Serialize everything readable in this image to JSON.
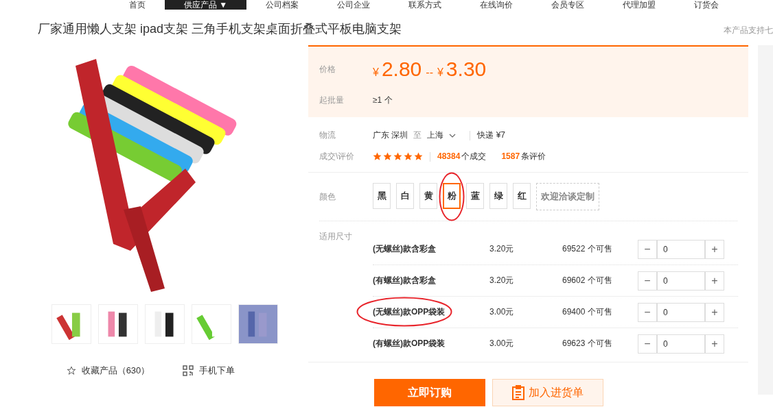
{
  "nav": [
    {
      "label": "首页",
      "selected": false
    },
    {
      "label": "供应产品 ▼",
      "selected": true
    },
    {
      "label": "公司档案",
      "selected": false
    },
    {
      "label": "公司企业",
      "selected": false
    },
    {
      "label": "联系方式",
      "selected": false
    },
    {
      "label": "在线询价",
      "selected": false
    },
    {
      "label": "会员专区",
      "selected": false
    },
    {
      "label": "代理加盟",
      "selected": false
    },
    {
      "label": "订货会",
      "selected": false
    }
  ],
  "title": "厂家通用懒人支架 ipad支架 三角手机支架桌面折叠式平板电脑支架",
  "side_note": "本产品支持七",
  "gallery": {
    "thumbnails": [
      {
        "selected": false
      },
      {
        "selected": false
      },
      {
        "selected": false
      },
      {
        "selected": false
      },
      {
        "selected": false
      }
    ],
    "favorite": "收藏产品（630）",
    "mobile_order": "手机下单"
  },
  "price": {
    "label": "价格",
    "currency_1": "¥",
    "low": "2.80",
    "separator": "--",
    "currency_2": "¥",
    "high": "3.30",
    "moq_label": "起批量",
    "moq": "≥1 个"
  },
  "logistics": {
    "label": "物流",
    "from": "广东 深圳",
    "to_word": "至",
    "to": "上海",
    "method": "快递 ¥7"
  },
  "deals": {
    "label": "成交\\评价",
    "stars": 5,
    "deal_count": "48384",
    "deal_suffix": "个成交",
    "review_count": "1587",
    "review_suffix": "条评价"
  },
  "colors": {
    "label": "颜色",
    "options": [
      {
        "label": "黑",
        "selected": false,
        "circled": false
      },
      {
        "label": "白",
        "selected": false,
        "circled": false
      },
      {
        "label": "黄",
        "selected": false,
        "circled": false
      },
      {
        "label": "粉",
        "selected": true,
        "circled": true
      },
      {
        "label": "蓝",
        "selected": false,
        "circled": false
      },
      {
        "label": "绿",
        "selected": false,
        "circled": false
      },
      {
        "label": "红",
        "selected": false,
        "circled": false
      }
    ],
    "custom": "欢迎洽谈定制"
  },
  "sizes": {
    "label": "适用尺寸",
    "rows": [
      {
        "name": "(无螺丝)款含彩盒",
        "price": "3.20元",
        "stock": "69522",
        "stock_suffix": "个可售",
        "minus": "−",
        "qty": "0",
        "plus": "+",
        "circled": false
      },
      {
        "name": "(有螺丝)款含彩盒",
        "price": "3.20元",
        "stock": "69602",
        "stock_suffix": "个可售",
        "minus": "−",
        "qty": "0",
        "plus": "+",
        "circled": false
      },
      {
        "name": "(无螺丝)款OPP袋装",
        "price": "3.00元",
        "stock": "69400",
        "stock_suffix": "个可售",
        "minus": "−",
        "qty": "0",
        "plus": "+",
        "circled": true
      },
      {
        "name": "(有螺丝)款OPP袋装",
        "price": "3.00元",
        "stock": "69623",
        "stock_suffix": "个可售",
        "minus": "−",
        "qty": "0",
        "plus": "+",
        "circled": false
      }
    ]
  },
  "actions": {
    "buy": "立即订购",
    "cart": "加入进货单"
  }
}
